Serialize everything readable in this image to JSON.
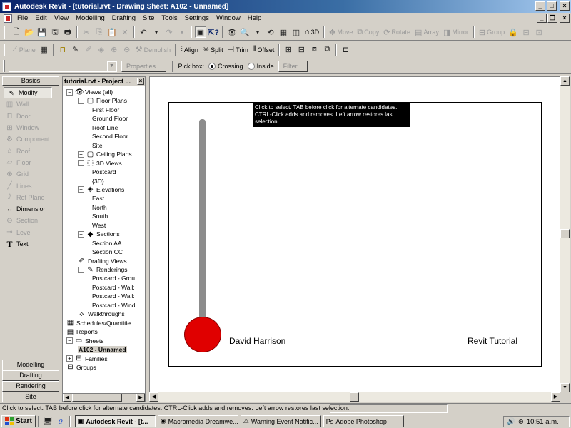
{
  "window": {
    "title": "Autodesk Revit - [tutorial.rvt - Drawing Sheet: A102 - Unnamed]"
  },
  "menu": [
    "File",
    "Edit",
    "View",
    "Modelling",
    "Drafting",
    "Site",
    "Tools",
    "Settings",
    "Window",
    "Help"
  ],
  "toolbar1": {
    "labels": {
      "3d": "3D",
      "move": "Move",
      "copy": "Copy",
      "rotate": "Rotate",
      "array": "Array",
      "mirror": "Mirror",
      "group": "Group"
    }
  },
  "toolbar2": {
    "labels": {
      "plane": "Plane",
      "demolish": "Demolish",
      "align": "Align",
      "split": "Split",
      "trim": "Trim",
      "offset": "Offset"
    }
  },
  "options_bar": {
    "type_value": "",
    "properties_label": "Properties...",
    "pick_box_label": "Pick box:",
    "crossing_label": "Crossing",
    "inside_label": "Inside",
    "filter_label": "Filter..."
  },
  "design_bar": {
    "active_tab": "Basics",
    "tools": [
      {
        "label": "Modify",
        "icon": "cursor-arrow-icon",
        "enabled": true,
        "selected": true
      },
      {
        "label": "Wall",
        "icon": "wall-icon",
        "enabled": false
      },
      {
        "label": "Door",
        "icon": "door-icon",
        "enabled": false
      },
      {
        "label": "Window",
        "icon": "window-icon",
        "enabled": false
      },
      {
        "label": "Component",
        "icon": "component-icon",
        "enabled": false
      },
      {
        "label": "Roof",
        "icon": "roof-icon",
        "enabled": false
      },
      {
        "label": "Floor",
        "icon": "floor-icon",
        "enabled": false
      },
      {
        "label": "Grid",
        "icon": "grid-icon",
        "enabled": false
      },
      {
        "label": "Lines",
        "icon": "lines-icon",
        "enabled": false
      },
      {
        "label": "Ref Plane",
        "icon": "ref-plane-icon",
        "enabled": false
      },
      {
        "label": "Dimension",
        "icon": "dimension-icon",
        "enabled": true
      },
      {
        "label": "Section",
        "icon": "section-icon",
        "enabled": false
      },
      {
        "label": "Level",
        "icon": "level-icon",
        "enabled": false
      },
      {
        "label": "Text",
        "icon": "text-icon",
        "enabled": true
      }
    ],
    "bottom_tabs": [
      "Modelling",
      "Drafting",
      "Rendering",
      "Site"
    ]
  },
  "project_browser": {
    "title": "tutorial.rvt - Project ...",
    "tree": [
      {
        "label": "Views (all)",
        "level": 0,
        "exp": "-",
        "icon": "eye-icon"
      },
      {
        "label": "Floor Plans",
        "level": 1,
        "exp": "-",
        "icon": "floor-plan-icon"
      },
      {
        "label": "First Floor",
        "level": 2
      },
      {
        "label": "Ground Floor",
        "level": 2
      },
      {
        "label": "Roof Line",
        "level": 2
      },
      {
        "label": "Second Floor",
        "level": 2
      },
      {
        "label": "Site",
        "level": 2
      },
      {
        "label": "Ceiling Plans",
        "level": 1,
        "exp": "+",
        "icon": "ceiling-plan-icon"
      },
      {
        "label": "3D Views",
        "level": 1,
        "exp": "-",
        "icon": "cube-icon"
      },
      {
        "label": "Postcard",
        "level": 2
      },
      {
        "label": "{3D}",
        "level": 2
      },
      {
        "label": "Elevations",
        "level": 1,
        "exp": "-",
        "icon": "elevation-icon"
      },
      {
        "label": "East",
        "level": 2
      },
      {
        "label": "North",
        "level": 2
      },
      {
        "label": "South",
        "level": 2
      },
      {
        "label": "West",
        "level": 2
      },
      {
        "label": "Sections",
        "level": 1,
        "exp": "-",
        "icon": "section-view-icon"
      },
      {
        "label": "Section AA",
        "level": 2
      },
      {
        "label": "Section CC",
        "level": 2
      },
      {
        "label": "Drafting Views",
        "level": 1,
        "icon": "drafting-icon"
      },
      {
        "label": "Renderings",
        "level": 1,
        "exp": "-",
        "icon": "rendering-icon"
      },
      {
        "label": "Postcard - Grou",
        "level": 2
      },
      {
        "label": "Postcard - Wall:",
        "level": 2
      },
      {
        "label": "Postcard - Wall:",
        "level": 2
      },
      {
        "label": "Postcard - Wind",
        "level": 2
      },
      {
        "label": "Walkthroughs",
        "level": 1,
        "icon": "walkthrough-icon"
      },
      {
        "label": "Schedules/Quantitie",
        "level": 0,
        "icon": "schedule-icon"
      },
      {
        "label": "Reports",
        "level": 0,
        "icon": "report-icon"
      },
      {
        "label": "Sheets",
        "level": 0,
        "exp": "-",
        "icon": "sheet-icon"
      },
      {
        "label": "A102 - Unnamed",
        "level": 1,
        "selected": true
      },
      {
        "label": "Families",
        "level": 0,
        "exp": "+",
        "icon": "family-icon"
      },
      {
        "label": "Groups",
        "level": 0,
        "icon": "group-icon"
      }
    ]
  },
  "drawing": {
    "tooltip": "Click to select. TAB before click for alternate candidates. CTRL-Click adds and removes. Left arrow restores last selection.",
    "title_block_left": "David Harrison",
    "title_block_right": "Revit Tutorial"
  },
  "status_bar": {
    "text": "Click to select. TAB before click for alternate candidates. CTRL-Click adds and removes. Left arrow restores last selection."
  },
  "taskbar": {
    "start_label": "Start",
    "tasks": [
      {
        "label": "Autodesk Revit - [t...",
        "active": true,
        "icon": "revit-icon"
      },
      {
        "label": "Macromedia Dreamwe...",
        "active": false,
        "icon": "dreamweaver-icon"
      },
      {
        "label": "Warning Event Notific...",
        "active": false,
        "icon": "warning-icon"
      },
      {
        "label": "Adobe Photoshop",
        "active": false,
        "icon": "photoshop-icon"
      }
    ],
    "clock": "10:51 a.m."
  },
  "colors": {
    "title_start": "#0a246a",
    "title_end": "#a6caf0",
    "selection_ball": "#e00000",
    "thermometer": "#8c8c8c"
  }
}
